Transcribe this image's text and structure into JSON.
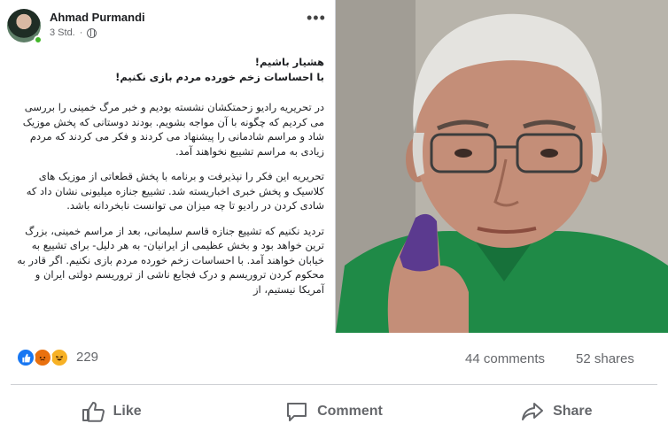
{
  "post": {
    "author": "Ahmad Purmandi",
    "time": "3 Std.",
    "separator": "·",
    "more": "•••",
    "text": {
      "headline_1": "هشیار باشیم!",
      "headline_2": "با احساسات زخم خورده مردم بازی نکنیم!",
      "p1": "در تحریریه رادیو زحمتکشان نشسته بودیم و خبر مرگ خمینی را بررسی می کردیم که چگونه با آن مواجه بشویم. بودند دوستانی که پخش موزیک شاد و مراسم شادمانی را پیشنهاد می کردند و فکر می کردند که مردم زیادی به مراسم تشییع نخواهند آمد.",
      "p2": "تحریریه این فکر را نپذیرفت و برنامه با پخش قطعاتی از موزیک های کلاسیک و پخش خبری اخباریسته شد. تشییع جنازه میلیونی نشان داد که شادی کردن در رادیو تا چه میزان می توانست نابخردانه باشد.",
      "p3": "تردید نکنیم که تشییع جنازه قاسم سلیمانی، بعد از مراسم خمینی، بزرگ ترین خواهد بود و بخش عظیمی از ایرانیان- به هر دلیل- برای تشییع به خیابان خواهند آمد. با احساسات زخم خورده مردم بازی نکنیم. اگر قادر به محکوم کردن تروریسم و درک فجایع ناشی از تروریسم دولتی ایران و آمریکا نیستیم، از"
    }
  },
  "stats": {
    "reactions_count": "229",
    "comments": "44 comments",
    "shares": "52 shares",
    "reaction_icons": [
      "like-icon",
      "angry-icon",
      "haha-icon"
    ]
  },
  "actions": {
    "like": "Like",
    "comment": "Comment",
    "share": "Share"
  },
  "colors": {
    "fb_blue": "#1877f2",
    "text_secondary": "#65676b",
    "shirt_green": "#1f8a47",
    "ink_purple": "#5b3a8f"
  }
}
